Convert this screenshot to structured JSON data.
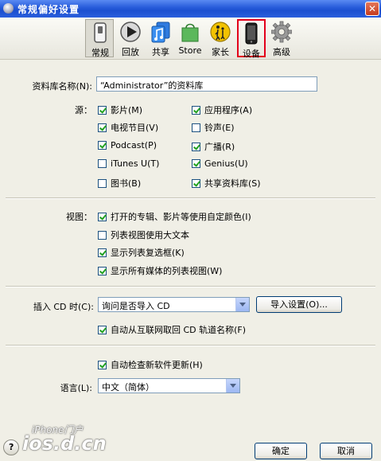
{
  "window": {
    "title": "常规偏好设置"
  },
  "toolbar": {
    "items": [
      {
        "id": "general",
        "label": "常规",
        "icon": "switch-icon"
      },
      {
        "id": "playback",
        "label": "回放",
        "icon": "play-icon"
      },
      {
        "id": "sharing",
        "label": "共享",
        "icon": "music-share-icon"
      },
      {
        "id": "store",
        "label": "Store",
        "icon": "shopping-bag-icon"
      },
      {
        "id": "parental",
        "label": "家长",
        "icon": "parental-icon"
      },
      {
        "id": "devices",
        "label": "设备",
        "icon": "iphone-icon"
      },
      {
        "id": "advanced",
        "label": "高级",
        "icon": "gear-icon"
      }
    ]
  },
  "library": {
    "label": "资料库名称(N):",
    "value": "“Administrator”的资料库"
  },
  "sources": {
    "label": "源：",
    "items": [
      {
        "label": "影片(M)",
        "checked": true
      },
      {
        "label": "应用程序(A)",
        "checked": true
      },
      {
        "label": "电视节目(V)",
        "checked": true
      },
      {
        "label": "铃声(E)",
        "checked": false
      },
      {
        "label": "Podcast(P)",
        "checked": true
      },
      {
        "label": "广播(R)",
        "checked": true
      },
      {
        "label": "iTunes U(T)",
        "checked": false
      },
      {
        "label": "Genius(U)",
        "checked": true
      },
      {
        "label": "图书(B)",
        "checked": false
      },
      {
        "label": "共享资料库(S)",
        "checked": true
      }
    ]
  },
  "views": {
    "label": "视图：",
    "items": [
      {
        "label": "打开的专辑、影片等使用自定颜色(I)",
        "checked": true
      },
      {
        "label": "列表视图使用大文本",
        "checked": false
      },
      {
        "label": "显示列表复选框(K)",
        "checked": true
      },
      {
        "label": "显示所有媒体的列表视图(W)",
        "checked": true
      }
    ]
  },
  "cd": {
    "label": "插入 CD 时(C):",
    "selected": "询问是否导入 CD",
    "import_button": "导入设置(O)...",
    "auto_names": {
      "label": "自动从互联网取回 CD 轨道名称(F)",
      "checked": true
    }
  },
  "updates": {
    "label": "自动检查新软件更新(H)",
    "checked": true
  },
  "language": {
    "label": "语言(L):",
    "selected": "中文（简体）"
  },
  "buttons": {
    "ok": "确定",
    "cancel": "取消"
  },
  "watermark": {
    "brand": "iPhone门户",
    "site": "ios.d.cn"
  },
  "colors": {
    "titlebar": "#2a5fdc",
    "highlight": "#e3001b",
    "check": "#21a121"
  }
}
